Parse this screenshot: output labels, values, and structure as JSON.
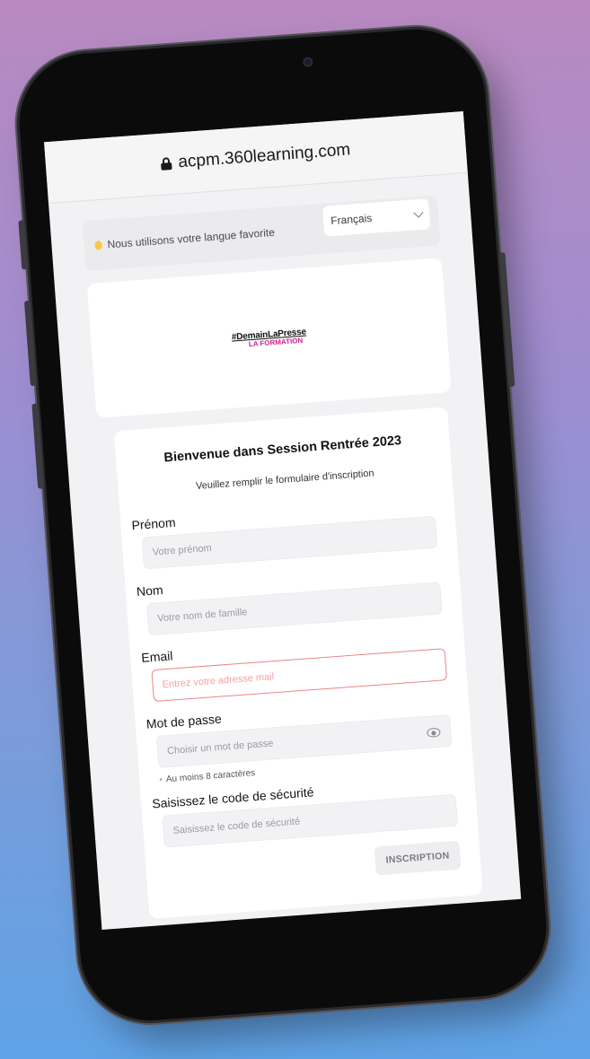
{
  "browser": {
    "url": "acpm.360learning.com"
  },
  "language_bar": {
    "message": "Nous utilisons votre langue favorite",
    "selected_language": "Français"
  },
  "logo": {
    "line1": "#DemainLaPresse",
    "line2": "LA FORMATION"
  },
  "form": {
    "title": "Bienvenue dans Session Rentrée 2023",
    "subtitle": "Veuillez remplir le formulaire d'inscription",
    "fields": [
      {
        "label": "Prénom",
        "placeholder": "Votre prénom"
      },
      {
        "label": "Nom",
        "placeholder": "Votre nom de famille"
      },
      {
        "label": "Email",
        "placeholder": "Entrez votre adresse mail"
      },
      {
        "label": "Mot de passe",
        "placeholder": "Choisir un mot de passe"
      },
      {
        "label": "Saisissez le code de sécurité",
        "placeholder": "Saisissez le code de sécurité"
      }
    ],
    "password_hint": "Au moins 8 caractères",
    "submit_label": "INSCRIPTION"
  },
  "colors": {
    "error_border": "#e9868a",
    "logo_accent": "#d0218b",
    "background_top": "#b98ac0",
    "background_bottom": "#5fa3e6"
  }
}
